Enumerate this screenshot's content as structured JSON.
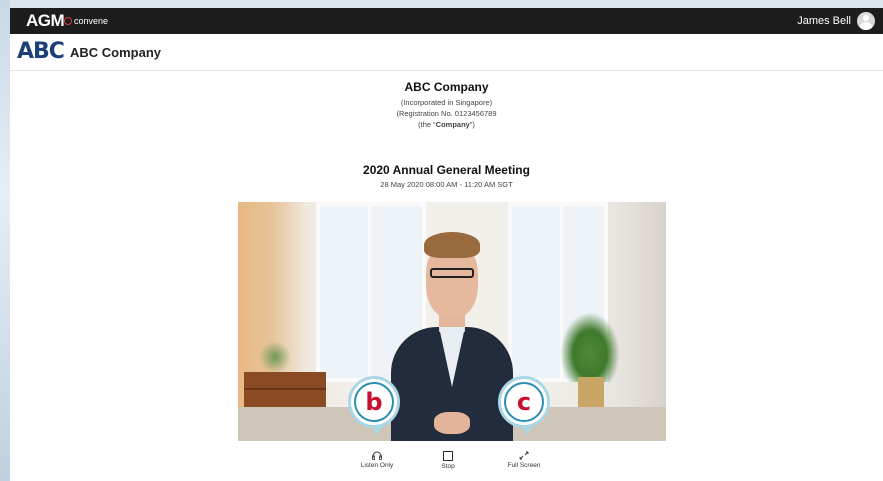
{
  "header": {
    "brand": "AGM",
    "brand_sub": "convene",
    "user_name": "James Bell",
    "avatar_icon": "user-avatar-icon"
  },
  "company_bar": {
    "logo_text": "ABC",
    "company_name": "ABC Company"
  },
  "meeting": {
    "company_title": "ABC Company",
    "incorporation": "(Incorporated in Singapore)",
    "registration": "(Registration No. 0123456789",
    "the_prefix": "(the “",
    "the_company": "Company",
    "the_suffix": "”)",
    "title": "2020 Annual General Meeting",
    "datetime": "28 May 2020 08:00 AM - 11:20 AM SGT"
  },
  "callouts": [
    "b",
    "c"
  ],
  "controls": {
    "listen_only": "Listen Only",
    "stop": "Stop",
    "full_screen": "Full Screen"
  },
  "colors": {
    "topbar": "#1d1d1d",
    "logo": "#1c3f78",
    "callout_letter": "#c8102e",
    "callout_ring": "#2b8db3"
  }
}
